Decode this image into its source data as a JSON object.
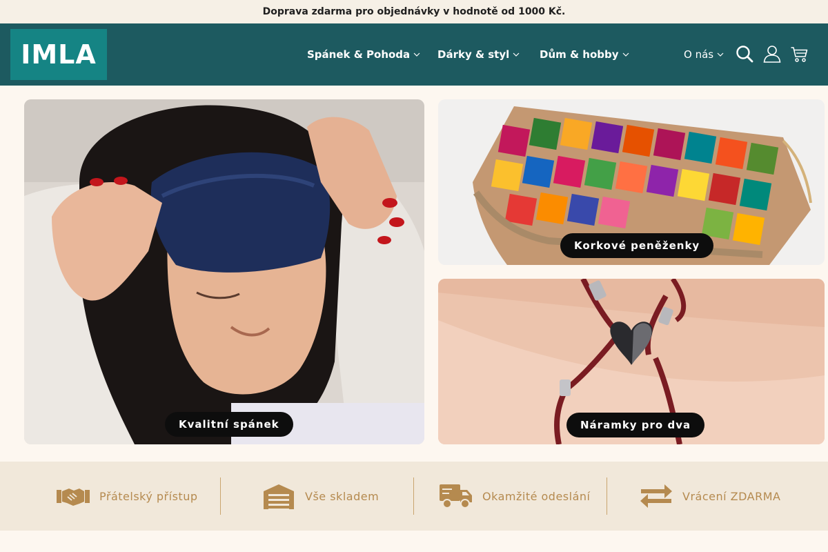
{
  "announcement": "Doprava zdarma  pro objednávky v hodnotě od 1000 Kč.",
  "logo": "IMLA",
  "nav": {
    "items": [
      {
        "label": "Spánek & Pohoda"
      },
      {
        "label": "Dárky & styl"
      },
      {
        "label": "Dům & hobby"
      },
      {
        "label": "O nás"
      }
    ]
  },
  "header_icons": [
    "search-icon",
    "user-icon",
    "cart-icon"
  ],
  "tiles": [
    {
      "label": "Kvalitní spánek"
    },
    {
      "label": "Korkové peněženky"
    },
    {
      "label": "Náramky pro dva"
    }
  ],
  "features": [
    {
      "label": "Přátelský přístup",
      "icon": "handshake-icon"
    },
    {
      "label": "Vše skladem",
      "icon": "warehouse-icon"
    },
    {
      "label": "Okamžité odeslání",
      "icon": "truck-icon"
    },
    {
      "label": "Vrácení ZDARMA",
      "icon": "exchange-icon"
    }
  ],
  "colors": {
    "header_bg": "#1d5a60",
    "logo_bg": "#158484",
    "feature_accent": "#b58a4f",
    "page_bg": "#fdf7f0"
  }
}
